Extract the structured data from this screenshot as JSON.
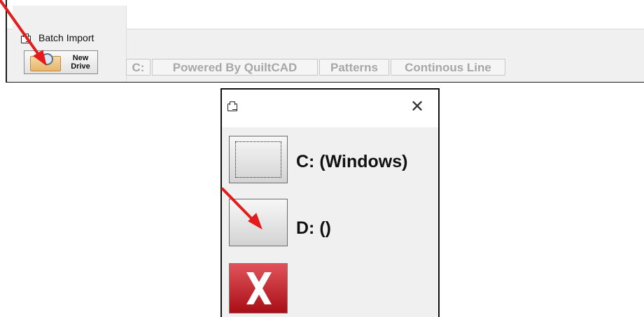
{
  "batch_import": {
    "title": "Batch Import",
    "title_icon": "folder-icon",
    "new_drive_button": {
      "line1": "New",
      "line2": "Drive",
      "icon": "magnifier-drive-icon"
    },
    "path_segments": [
      "C:",
      "Powered By QuiltCAD",
      "Patterns",
      "Continous Line"
    ]
  },
  "drive_dialog": {
    "title_icon": "folder-icon",
    "close_icon": "close-icon",
    "close_glyph": "✕",
    "drives": [
      {
        "label": "C: (Windows)"
      },
      {
        "label": "D: ()"
      }
    ],
    "cancel_icon": "red-x-icon"
  },
  "annotations": {
    "arrow_color": "#e31b1b"
  },
  "colors": {
    "path_text": "#a7a7a7",
    "cancel_red": "#c21a22"
  }
}
